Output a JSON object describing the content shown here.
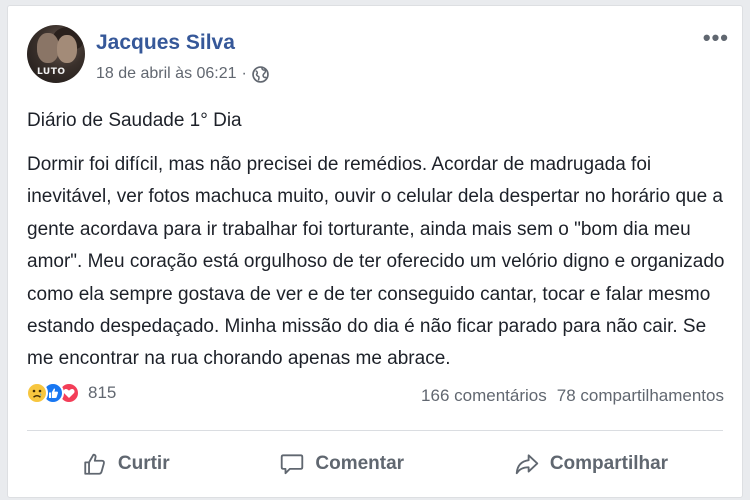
{
  "post": {
    "author": "Jacques Silva",
    "avatar_badge": "LUTO",
    "timestamp": "18 de abril às 06:21",
    "separator": "·",
    "audience_icon": "globe-icon",
    "more_icon": "more-options-icon",
    "more_label": "•••",
    "title": "Diário de Saudade 1° Dia",
    "body": "Dormir foi difícil, mas não precisei de remédios. Acordar de madrugada foi inevitável, ver fotos machuca muito, ouvir o celular dela despertar no horário que a gente acordava para ir trabalhar foi torturante, ainda mais sem o \"bom dia meu amor\". Meu coração está orgulhoso de ter oferecido um velório digno e organizado como ela sempre gostava de ver e de ter conseguido cantar, tocar e falar mesmo estando despedaçado. Minha missão do dia é não ficar parado para não cair. Se me encontrar na rua chorando apenas me abrace."
  },
  "reactions": {
    "icons": [
      "sad-reaction-icon",
      "like-reaction-icon",
      "love-reaction-icon"
    ],
    "count": "815"
  },
  "stats": {
    "comments": "166 comentários",
    "shares": "78 compartilhamentos"
  },
  "actions": {
    "like": "Curtir",
    "comment": "Comentar",
    "share": "Compartilhar"
  },
  "colors": {
    "author_link": "#365899",
    "secondary_text": "#616770",
    "primary_text": "#1d2129",
    "like_blue": "#1877f2",
    "love_red": "#f33e58",
    "sad_yellow": "#f7c63f"
  }
}
